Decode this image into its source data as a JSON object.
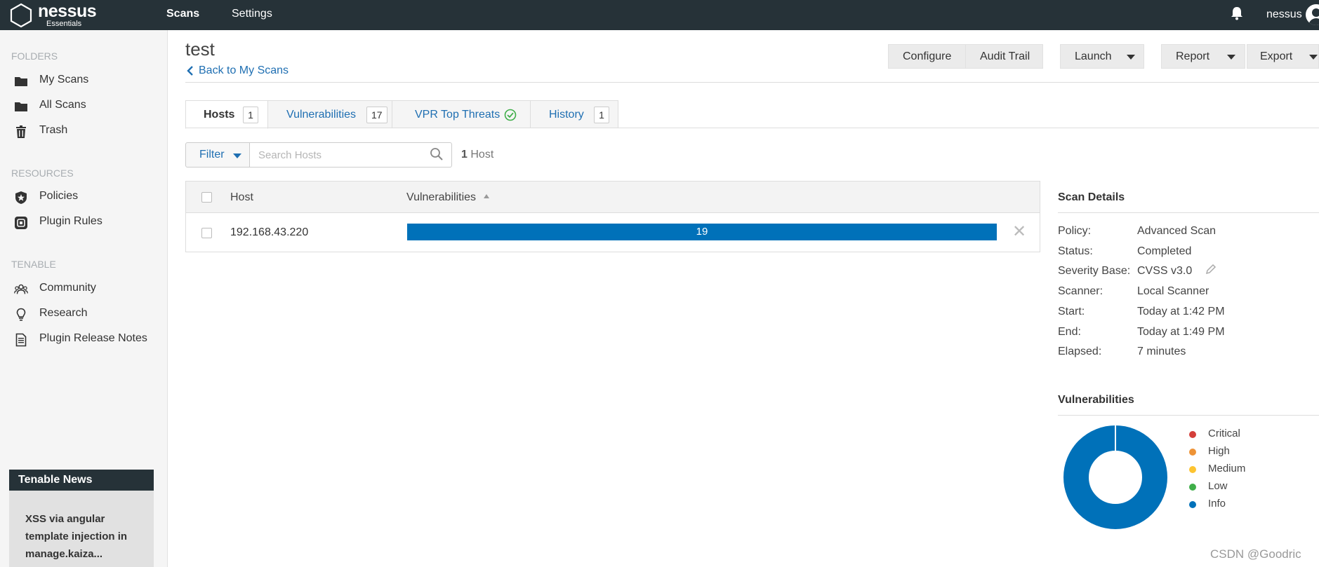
{
  "topbar": {
    "logo_name": "nessus",
    "logo_sub": "Essentials",
    "nav": [
      "Scans",
      "Settings"
    ],
    "username": "nessus"
  },
  "sidebar": {
    "folders_title": "FOLDERS",
    "folders": [
      {
        "label": "My Scans",
        "icon": "folder-icon"
      },
      {
        "label": "All Scans",
        "icon": "folder-icon"
      },
      {
        "label": "Trash",
        "icon": "trash-icon"
      }
    ],
    "resources_title": "RESOURCES",
    "resources": [
      {
        "label": "Policies",
        "icon": "shield-icon"
      },
      {
        "label": "Plugin Rules",
        "icon": "plugin-icon"
      }
    ],
    "tenable_title": "TENABLE",
    "tenable": [
      {
        "label": "Community",
        "icon": "people-icon"
      },
      {
        "label": "Research",
        "icon": "lightbulb-icon"
      },
      {
        "label": "Plugin Release Notes",
        "icon": "document-icon"
      }
    ],
    "news_title": "Tenable News",
    "news_item": "XSS via angular template injection in manage.kaiza..."
  },
  "main": {
    "title": "test",
    "back_link": "Back to My Scans",
    "toolbar": {
      "configure": "Configure",
      "audit_trail": "Audit Trail",
      "launch": "Launch",
      "report": "Report",
      "export": "Export"
    },
    "tabs": [
      {
        "label": "Hosts",
        "count": "1"
      },
      {
        "label": "Vulnerabilities",
        "count": "17"
      },
      {
        "label": "VPR Top Threats"
      },
      {
        "label": "History",
        "count": "1"
      }
    ],
    "filter_label": "Filter",
    "search_placeholder": "Search Hosts",
    "host_count_num": "1",
    "host_count_label": "Host",
    "table": {
      "col_host": "Host",
      "col_vulns": "Vulnerabilities",
      "rows": [
        {
          "host": "192.168.43.220",
          "vulns": "19"
        }
      ]
    }
  },
  "scan_details": {
    "title": "Scan Details",
    "rows": [
      {
        "label": "Policy:",
        "value": "Advanced Scan"
      },
      {
        "label": "Status:",
        "value": "Completed"
      },
      {
        "label": "Severity Base:",
        "value": "CVSS v3.0"
      },
      {
        "label": "Scanner:",
        "value": "Local Scanner"
      },
      {
        "label": "Start:",
        "value": "Today at 1:42 PM"
      },
      {
        "label": "End:",
        "value": "Today at 1:49 PM"
      },
      {
        "label": "Elapsed:",
        "value": "7 minutes"
      }
    ]
  },
  "vuln_summary": {
    "title": "Vulnerabilities",
    "legend": [
      {
        "label": "Critical",
        "color": "#d43f3a"
      },
      {
        "label": "High",
        "color": "#ee9336"
      },
      {
        "label": "Medium",
        "color": "#fdc431"
      },
      {
        "label": "Low",
        "color": "#3fae49"
      },
      {
        "label": "Info",
        "color": "#0071b9"
      }
    ]
  },
  "watermark": "CSDN @Goodric"
}
